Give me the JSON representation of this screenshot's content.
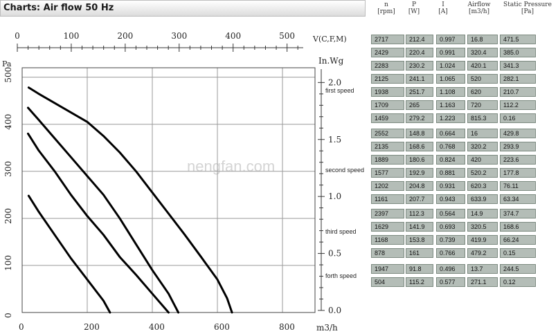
{
  "chart_data": {
    "type": "line",
    "title": "Charts: Air flow 50 Hz",
    "watermark": "nengfan.com",
    "x_axis_bottom": {
      "unit_label": "m3/h",
      "ticks": [
        0,
        200,
        400,
        600,
        800
      ],
      "range": [
        0,
        900
      ]
    },
    "x_axis_top": {
      "unit_label": "V(C,F,M)",
      "ticks": [
        0,
        100,
        200,
        300,
        400,
        500
      ],
      "range": [
        0,
        530
      ]
    },
    "y_axis_left": {
      "unit_label": "Pa",
      "ticks": [
        0,
        100,
        200,
        300,
        400,
        500
      ],
      "range": [
        0,
        520
      ]
    },
    "y_axis_right": {
      "unit_label": "In.Wg",
      "ticks": [
        "0.0",
        "0.5",
        "1.0",
        "1.5",
        "2.0"
      ],
      "range": [
        0.0,
        2.087
      ]
    },
    "grid": true,
    "series": [
      {
        "points": [
          [
            20,
            478
          ],
          [
            50,
            465
          ],
          [
            100,
            445
          ],
          [
            150,
            425
          ],
          [
            200,
            405
          ],
          [
            250,
            375
          ],
          [
            300,
            340
          ],
          [
            350,
            300
          ],
          [
            400,
            255
          ],
          [
            450,
            210
          ],
          [
            500,
            165
          ],
          [
            550,
            118
          ],
          [
            600,
            70
          ],
          [
            630,
            30
          ],
          [
            645,
            0
          ]
        ]
      },
      {
        "points": [
          [
            18,
            435
          ],
          [
            50,
            410
          ],
          [
            100,
            370
          ],
          [
            150,
            330
          ],
          [
            200,
            290
          ],
          [
            250,
            250
          ],
          [
            300,
            200
          ],
          [
            350,
            145
          ],
          [
            400,
            90
          ],
          [
            450,
            40
          ],
          [
            480,
            0
          ]
        ]
      },
      {
        "points": [
          [
            18,
            380
          ],
          [
            50,
            345
          ],
          [
            100,
            300
          ],
          [
            150,
            250
          ],
          [
            200,
            205
          ],
          [
            250,
            165
          ],
          [
            300,
            118
          ],
          [
            350,
            80
          ],
          [
            400,
            40
          ],
          [
            450,
            0
          ]
        ]
      },
      {
        "points": [
          [
            20,
            248
          ],
          [
            50,
            215
          ],
          [
            100,
            165
          ],
          [
            150,
            115
          ],
          [
            200,
            70
          ],
          [
            250,
            25
          ],
          [
            270,
            0
          ]
        ]
      }
    ]
  },
  "table": {
    "headers": [
      {
        "top": "n",
        "bottom": "[rpm]"
      },
      {
        "top": "P",
        "bottom": "[W]"
      },
      {
        "top": "I",
        "bottom": "[A]"
      },
      {
        "top": "Airflow",
        "bottom": "[m3/h]"
      },
      {
        "top": "Static Pressure",
        "bottom": "[Pa]"
      }
    ],
    "groups": [
      {
        "label": "first speed",
        "rows": [
          [
            "2717",
            "212.4",
            "0.997",
            "16.8",
            "471.5"
          ],
          [
            "2429",
            "220.4",
            "0.991",
            "320.4",
            "385.0"
          ],
          [
            "2283",
            "230.2",
            "1.024",
            "420.1",
            "341.3"
          ],
          [
            "2125",
            "241.1",
            "1.065",
            "520",
            "282.1"
          ],
          [
            "1938",
            "251.7",
            "1.108",
            "620",
            "210.7"
          ],
          [
            "1709",
            "265",
            "1.163",
            "720",
            "112.2"
          ],
          [
            "1459",
            "279.2",
            "1.223",
            "815.3",
            "0.16"
          ]
        ]
      },
      {
        "label": "second speed",
        "rows": [
          [
            "2552",
            "148.8",
            "0.664",
            "16",
            "429.8"
          ],
          [
            "2135",
            "168.6",
            "0.768",
            "320.2",
            "293.9"
          ],
          [
            "1889",
            "180.6",
            "0.824",
            "420",
            "223.6"
          ],
          [
            "1577",
            "192.9",
            "0.881",
            "520.2",
            "177.8"
          ],
          [
            "1202",
            "204.8",
            "0.931",
            "620.3",
            "76.11"
          ],
          [
            "1161",
            "207.7",
            "0.943",
            "633.9",
            "63.34"
          ]
        ]
      },
      {
        "label": "third speed",
        "rows": [
          [
            "2397",
            "112.3",
            "0.564",
            "14.9",
            "374.7"
          ],
          [
            "1629",
            "141.9",
            "0.693",
            "320.5",
            "168.6"
          ],
          [
            "1168",
            "153.8",
            "0.739",
            "419.9",
            "66.24"
          ],
          [
            "878",
            "161",
            "0.766",
            "479.2",
            "0.15"
          ]
        ]
      },
      {
        "label": "forth speed",
        "rows": [
          [
            "1947",
            "91.8",
            "0.496",
            "13.7",
            "244.5"
          ],
          [
            "504",
            "115.2",
            "0.577",
            "271.1",
            "0.12"
          ]
        ]
      }
    ]
  }
}
